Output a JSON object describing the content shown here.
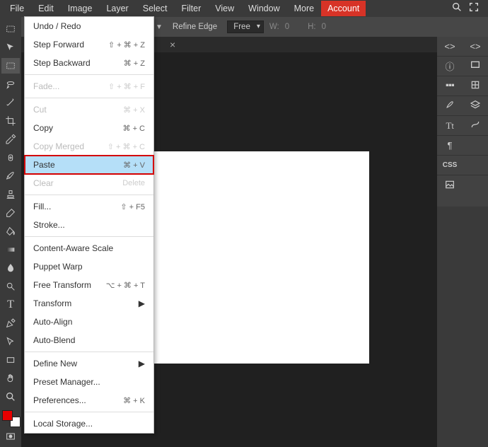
{
  "menubar": [
    "File",
    "Edit",
    "Image",
    "Layer",
    "Select",
    "Filter",
    "View",
    "Window",
    "More",
    "Account"
  ],
  "optionbar": {
    "refine": "Refine Edge",
    "mode": "Free",
    "wlabel": "W:",
    "wval": "0",
    "hlabel": "H:",
    "hval": "0"
  },
  "tab": {
    "close": "×"
  },
  "editMenu": [
    {
      "t": "item",
      "label": "Undo / Redo",
      "sc": ""
    },
    {
      "t": "item",
      "label": "Step Forward",
      "sc": "⇧ + ⌘ + Z"
    },
    {
      "t": "item",
      "label": "Step Backward",
      "sc": "⌘ + Z"
    },
    {
      "t": "sep"
    },
    {
      "t": "item",
      "label": "Fade...",
      "sc": "⇧ + ⌘ + F",
      "disabled": true
    },
    {
      "t": "sep"
    },
    {
      "t": "item",
      "label": "Cut",
      "sc": "⌘ + X",
      "disabled": true
    },
    {
      "t": "item",
      "label": "Copy",
      "sc": "⌘ + C"
    },
    {
      "t": "item",
      "label": "Copy Merged",
      "sc": "⇧ + ⌘ + C",
      "disabled": true
    },
    {
      "t": "item",
      "label": "Paste",
      "sc": "⌘ + V",
      "highlight": true
    },
    {
      "t": "item",
      "label": "Clear",
      "sc": "Delete",
      "disabled": true
    },
    {
      "t": "sep"
    },
    {
      "t": "item",
      "label": "Fill...",
      "sc": "⇧ + F5"
    },
    {
      "t": "item",
      "label": "Stroke..."
    },
    {
      "t": "sep"
    },
    {
      "t": "item",
      "label": "Content-Aware Scale"
    },
    {
      "t": "item",
      "label": "Puppet Warp"
    },
    {
      "t": "item",
      "label": "Free Transform",
      "sc": "⌥ + ⌘ + T"
    },
    {
      "t": "item",
      "label": "Transform",
      "sub": true
    },
    {
      "t": "item",
      "label": "Auto-Align"
    },
    {
      "t": "item",
      "label": "Auto-Blend"
    },
    {
      "t": "sep"
    },
    {
      "t": "item",
      "label": "Define New",
      "sub": true
    },
    {
      "t": "item",
      "label": "Preset Manager..."
    },
    {
      "t": "item",
      "label": "Preferences...",
      "sc": "⌘ + K"
    },
    {
      "t": "sep"
    },
    {
      "t": "item",
      "label": "Local Storage..."
    }
  ],
  "rpanel": {
    "css": "CSS"
  }
}
